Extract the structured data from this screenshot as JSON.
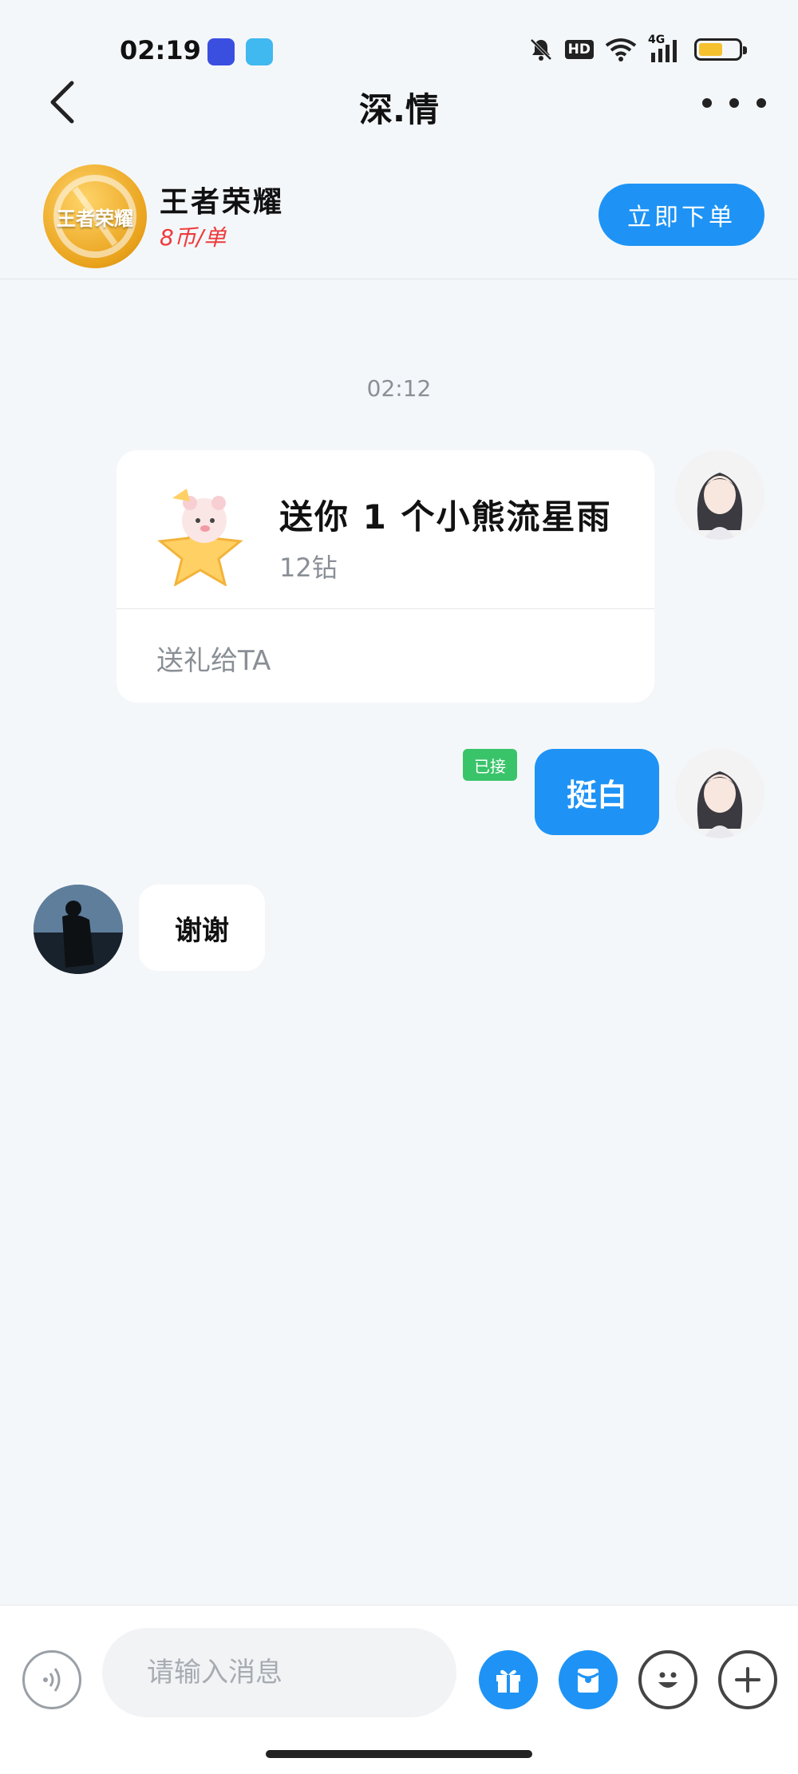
{
  "status_bar": {
    "time": "02:19",
    "icons": [
      "notification-app-icon",
      "chat-app-icon",
      "bell-muted-icon",
      "hd-icon",
      "wifi-icon",
      "signal-4g-icon",
      "battery-icon"
    ],
    "hd": "HD",
    "network": "4G",
    "battery_level": 0.6,
    "battery_color": "#f5c12e"
  },
  "nav": {
    "title": "深.情"
  },
  "product": {
    "logo_text": "王者荣耀",
    "game_name": "王者荣耀",
    "price": "8币/单",
    "order_button": "立即下单"
  },
  "chat": {
    "timestamp": "02:12",
    "messages": [
      {
        "type": "gift",
        "side": "right",
        "title": "送你 1 个小熊流星雨",
        "price": "12钻",
        "action": "送礼给TA"
      },
      {
        "type": "text",
        "side": "right",
        "badge": "已接",
        "text": "挺白"
      },
      {
        "type": "text",
        "side": "left",
        "text": "谢谢"
      }
    ]
  },
  "input_bar": {
    "placeholder": "请输入消息"
  },
  "colors": {
    "accent": "#1e93f5",
    "price_red": "#ee3b3b",
    "badge_green": "#3ac46a",
    "background": "#f4f7fa"
  }
}
